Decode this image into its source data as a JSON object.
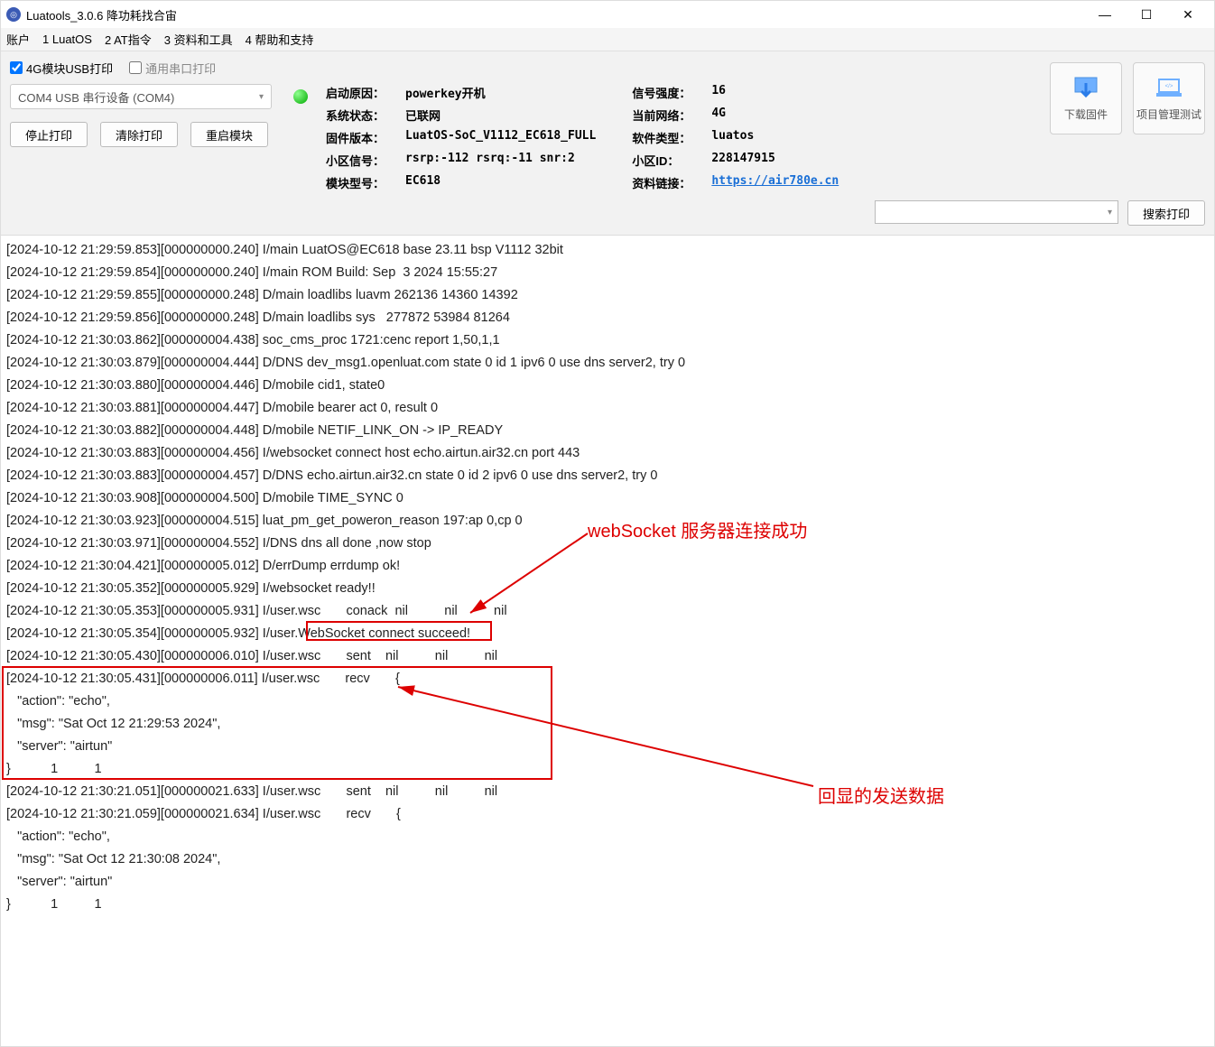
{
  "titlebar": {
    "title": "Luatools_3.0.6 降功耗找合宙"
  },
  "menu": {
    "m1": "账户",
    "m2": "1 LuatOS",
    "m3": "2 AT指令",
    "m4": "3 资料和工具",
    "m5": "4 帮助和支持"
  },
  "checks": {
    "usb": "4G模块USB打印",
    "serial": "通用串口打印"
  },
  "combo": {
    "text": "COM4 USB 串行设备 (COM4)"
  },
  "buttons": {
    "stop": "停止打印",
    "clear": "清除打印",
    "reboot": "重启模块",
    "search": "搜索打印"
  },
  "side": {
    "download": "下载固件",
    "project": "项目管理测试"
  },
  "info_left": {
    "k1": "启动原因：",
    "v1": "powerkey开机",
    "k2": "系统状态：",
    "v2": "已联网",
    "k3": "固件版本：",
    "v3": "LuatOS-SoC_V1112_EC618_FULL",
    "k4": "小区信号：",
    "v4": "rsrp:-112 rsrq:-11 snr:2",
    "k5": "模块型号：",
    "v5": "EC618"
  },
  "info_right": {
    "k1": "信号强度：",
    "v1": "16",
    "k2": "当前网络：",
    "v2": "4G",
    "k3": "软件类型：",
    "v3": "luatos",
    "k4": "小区ID：",
    "v4": "228147915",
    "k5": "资料链接：",
    "v5": "https://air780e.cn"
  },
  "annotations": {
    "a1": "webSocket 服务器连接成功",
    "a2": "回显的发送数据"
  },
  "log": [
    "[2024-10-12 21:29:59.853][000000000.240] I/main LuatOS@EC618 base 23.11 bsp V1112 32bit",
    "[2024-10-12 21:29:59.854][000000000.240] I/main ROM Build: Sep  3 2024 15:55:27",
    "[2024-10-12 21:29:59.855][000000000.248] D/main loadlibs luavm 262136 14360 14392",
    "[2024-10-12 21:29:59.856][000000000.248] D/main loadlibs sys   277872 53984 81264",
    "[2024-10-12 21:30:03.862][000000004.438] soc_cms_proc 1721:cenc report 1,50,1,1",
    "[2024-10-12 21:30:03.879][000000004.444] D/DNS dev_msg1.openluat.com state 0 id 1 ipv6 0 use dns server2, try 0",
    "[2024-10-12 21:30:03.880][000000004.446] D/mobile cid1, state0",
    "[2024-10-12 21:30:03.881][000000004.447] D/mobile bearer act 0, result 0",
    "[2024-10-12 21:30:03.882][000000004.448] D/mobile NETIF_LINK_ON -> IP_READY",
    "[2024-10-12 21:30:03.883][000000004.456] I/websocket connect host echo.airtun.air32.cn port 443",
    "[2024-10-12 21:30:03.883][000000004.457] D/DNS echo.airtun.air32.cn state 0 id 2 ipv6 0 use dns server2, try 0",
    "[2024-10-12 21:30:03.908][000000004.500] D/mobile TIME_SYNC 0",
    "[2024-10-12 21:30:03.923][000000004.515] luat_pm_get_poweron_reason 197:ap 0,cp 0",
    "[2024-10-12 21:30:03.971][000000004.552] I/DNS dns all done ,now stop",
    "[2024-10-12 21:30:04.421][000000005.012] D/errDump errdump ok!",
    "[2024-10-12 21:30:05.352][000000005.929] I/websocket ready!!",
    "[2024-10-12 21:30:05.353][000000005.931] I/user.wsc       conack  nil          nil          nil",
    "[2024-10-12 21:30:05.354][000000005.932] I/user.WebSocket connect succeed!",
    "[2024-10-12 21:30:05.430][000000006.010] I/user.wsc       sent    nil          nil          nil",
    "[2024-10-12 21:30:05.431][000000006.011] I/user.wsc       recv       {",
    "   \"action\": \"echo\",",
    "   \"msg\": \"Sat Oct 12 21:29:53 2024\",",
    "   \"server\": \"airtun\"",
    "}           1          1",
    "[2024-10-12 21:30:21.051][000000021.633] I/user.wsc       sent    nil          nil          nil",
    "[2024-10-12 21:30:21.059][000000021.634] I/user.wsc       recv       {",
    "   \"action\": \"echo\",",
    "   \"msg\": \"Sat Oct 12 21:30:08 2024\",",
    "   \"server\": \"airtun\"",
    "}           1          1"
  ]
}
